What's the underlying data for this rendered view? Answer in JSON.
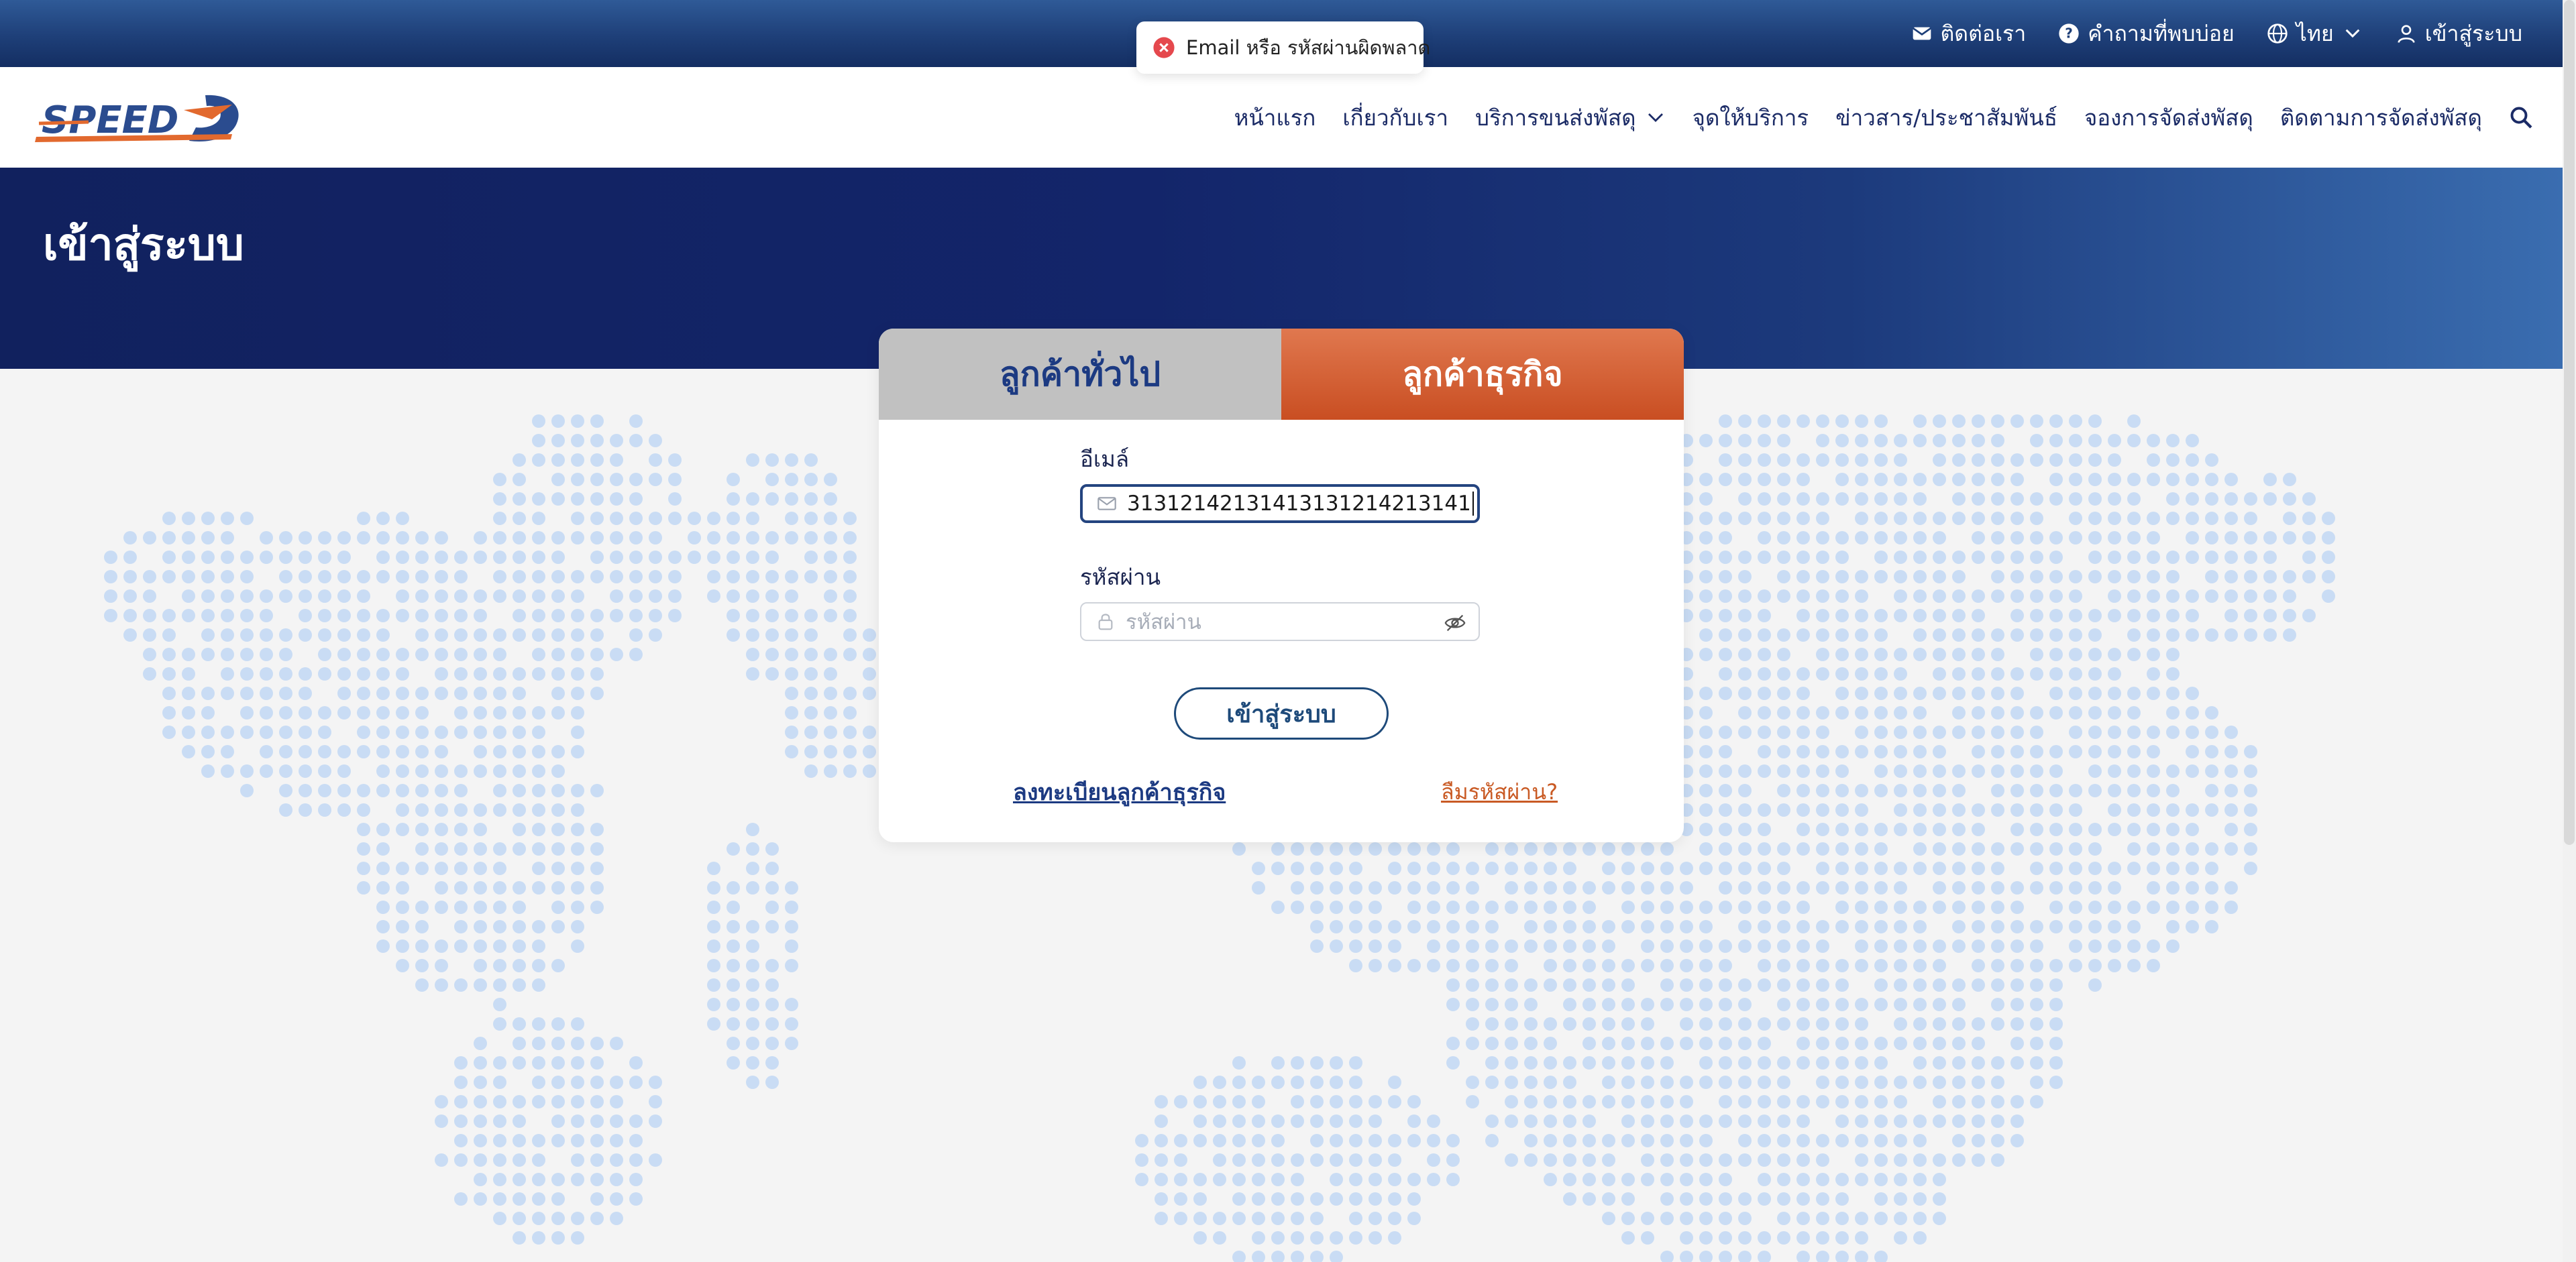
{
  "topbar": {
    "contact": "ติดต่อเรา",
    "faq": "คำถามที่พบบ่อย",
    "language": "ไทย",
    "login": "เข้าสู่ระบบ"
  },
  "toast": {
    "message": "Email หรือ รหัสผ่านผิดพลาด",
    "type": "error",
    "color": "#e5484d"
  },
  "nav": {
    "items": [
      {
        "label": "หน้าแรก",
        "has_dropdown": false
      },
      {
        "label": "เกี่ยวกับเรา",
        "has_dropdown": false
      },
      {
        "label": "บริการขนส่งพัสดุ",
        "has_dropdown": true
      },
      {
        "label": "จุดให้บริการ",
        "has_dropdown": false
      },
      {
        "label": "ข่าวสาร/ประชาสัมพันธ์",
        "has_dropdown": false
      },
      {
        "label": "จองการจัดส่งพัสดุ",
        "has_dropdown": false
      },
      {
        "label": "ติดตามการจัดส่งพัสดุ",
        "has_dropdown": false
      }
    ]
  },
  "hero": {
    "title": "เข้าสู่ระบบ"
  },
  "login": {
    "tabs": [
      {
        "label": "ลูกค้าทั่วไป",
        "active": false
      },
      {
        "label": "ลูกค้าธุรกิจ",
        "active": true
      }
    ],
    "email_label": "อีเมล์",
    "email_value": "31312142131413131214213141",
    "password_label": "รหัสผ่าน",
    "password_placeholder": "รหัสผ่าน",
    "submit_label": "เข้าสู่ระบบ",
    "register_link": "ลงทะเบียนลูกค้าธุรกิจ",
    "forgot_link": "ลืมรหัสผ่าน?"
  },
  "colors": {
    "primary_navy": "#13256a",
    "accent_orange": "#d9642f",
    "tab_inactive": "#c1c1c1",
    "map_dot": "#c9dcf4",
    "background": "#f4f4f4"
  }
}
